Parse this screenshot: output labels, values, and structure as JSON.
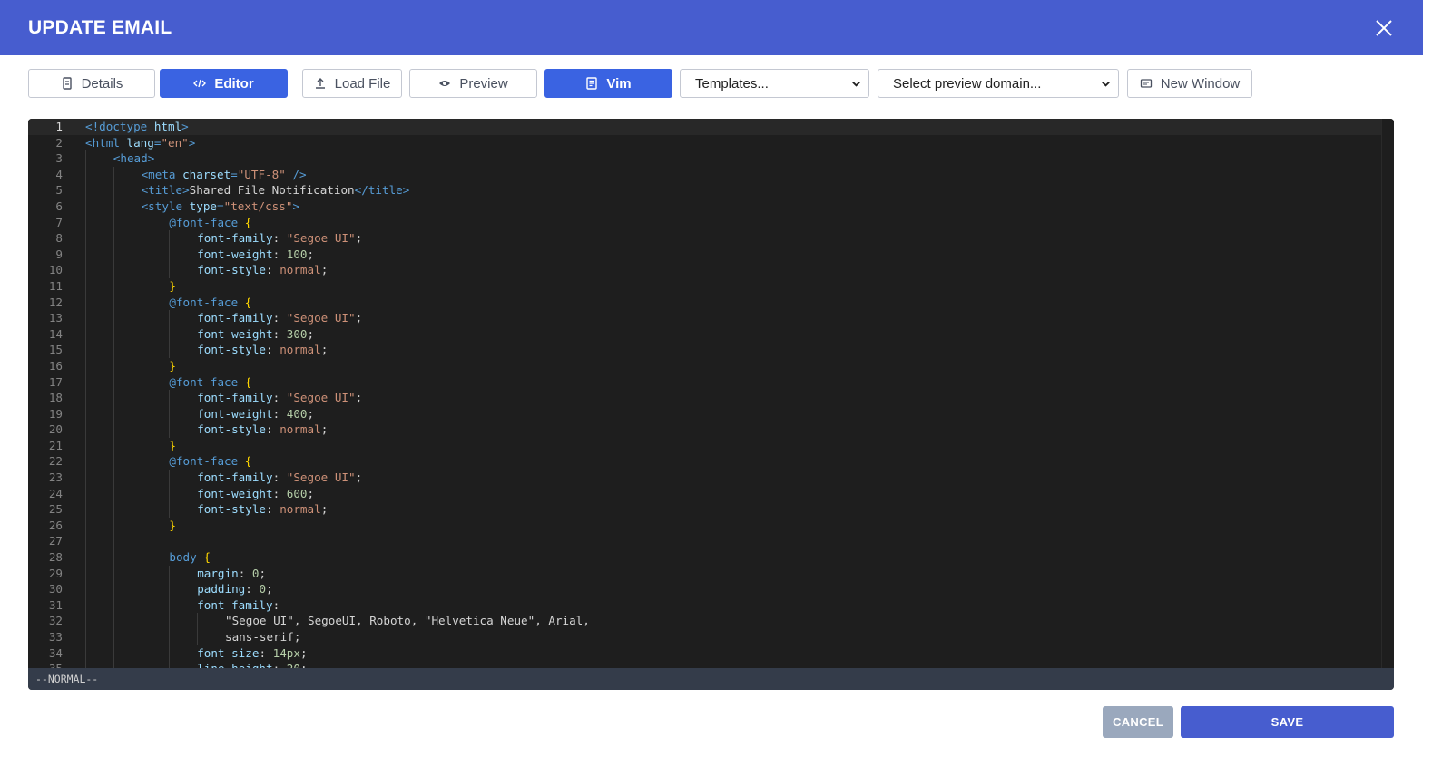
{
  "dialog": {
    "title": "UPDATE EMAIL"
  },
  "toolbar": {
    "details": "Details",
    "editor": "Editor",
    "load_file": "Load File",
    "preview": "Preview",
    "vim": "Vim",
    "templates": "Templates...",
    "preview_domain": "Select preview domain...",
    "new_window": "New Window"
  },
  "editor": {
    "mode": "--NORMAL--",
    "current_line": 1
  },
  "footer": {
    "cancel": "CANCEL",
    "save": "SAVE"
  },
  "colors": {
    "accent": "#475dcf",
    "active_button": "#3a63e2",
    "editor_bg": "#1e1e1e",
    "status_bg": "#343c4a"
  }
}
